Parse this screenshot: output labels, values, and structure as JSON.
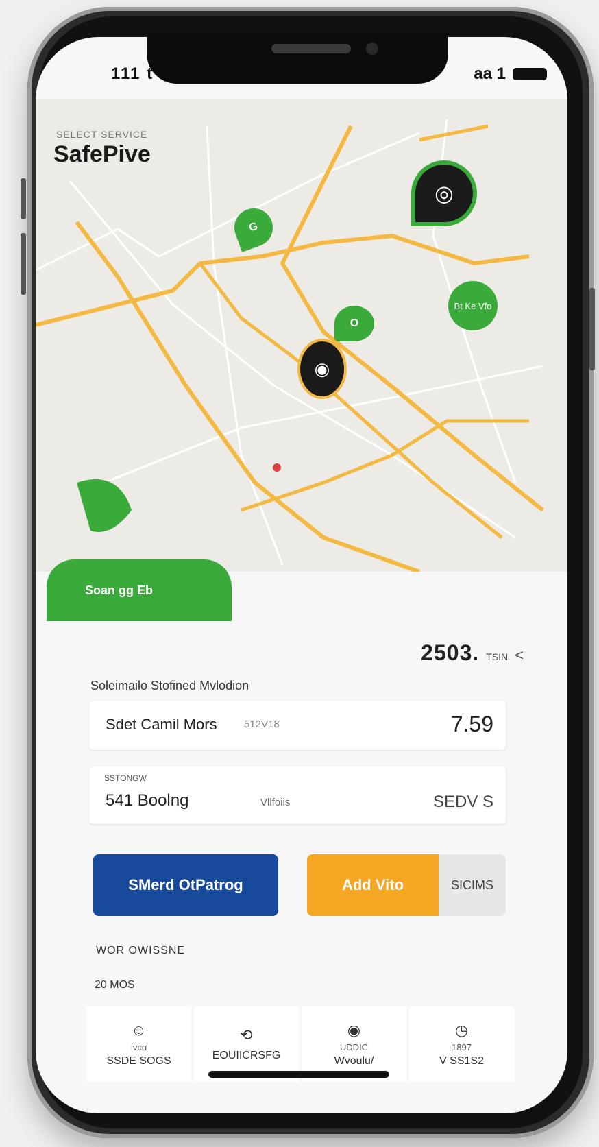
{
  "status": {
    "time": "111 t",
    "right": "aa 1"
  },
  "header": {
    "small": "SELECT SERVICE",
    "brand": "SafePive"
  },
  "map": {
    "markers": [
      {
        "name": "green-marker-1",
        "label": "G",
        "color": "#3aaa3a"
      },
      {
        "name": "dark-marker-1",
        "label": "◎",
        "color": "#1b1b1b"
      },
      {
        "name": "green-marker-2",
        "label": "O",
        "color": "#3aaa3a"
      },
      {
        "name": "green-marker-3",
        "label": "Bt Ke Vfo",
        "color": "#3aaa3a"
      },
      {
        "name": "dark-marker-2",
        "label": "◉",
        "color": "#1b1b1b"
      }
    ],
    "route_color": "#f4b942",
    "cta": "Soan gg Eb"
  },
  "metric": {
    "value": "2503.",
    "unit": "TSIN",
    "chevron": "<"
  },
  "section_title": "Soleimailo Stofined Mvlodion",
  "card1": {
    "name": "Sdet Camil Mors",
    "sub": "512V18",
    "value": "7.59"
  },
  "card2": {
    "label": "SSTONGW",
    "name": "541 Boolng",
    "mid": "Vllfoiis",
    "value": "SEDV S"
  },
  "actions": {
    "primary": "SMerd OtPatrog",
    "secondary": "Add Vito",
    "tertiary": "SICIMS"
  },
  "footer": {
    "label1": "WOR OWISSNE",
    "label2": "20 MOS"
  },
  "tabs": [
    {
      "icon": "☺",
      "t1": "ivco",
      "t2": "SSDE SOGS"
    },
    {
      "icon": "⟲",
      "t1": "",
      "t2": "EOUIICRSFG"
    },
    {
      "icon": "◉",
      "t1": "UDDIC",
      "t2": "Wvoulu/"
    },
    {
      "icon": "◷",
      "t1": "1897",
      "t2": "V SS1S2"
    }
  ],
  "colors": {
    "blue": "#174a9b",
    "orange": "#f5a623",
    "green": "#3aaa3a"
  }
}
